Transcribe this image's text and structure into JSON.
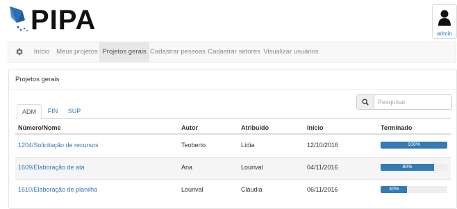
{
  "brand": {
    "name": "PIPA"
  },
  "user": {
    "name": "admin"
  },
  "nav": {
    "items": [
      "Início",
      "Meus projetos",
      "Projetos gerais",
      "Cadastrar pessoas",
      "Cadastrar setores",
      "Visualizar usuários"
    ],
    "active_index": 2
  },
  "panel": {
    "title": "Projetos gerais"
  },
  "search": {
    "placeholder": "Pesquisar"
  },
  "tabs": {
    "items": [
      "ADM",
      "FIN",
      "SUP"
    ],
    "active_index": 0
  },
  "table": {
    "headers": [
      "Número/Nome",
      "Autor",
      "Atribuido",
      "Início",
      "Terminado"
    ],
    "rows": [
      {
        "nome": "1204/Solicitação de recursos",
        "autor": "Teoberto",
        "atribuido": "Lídia",
        "inicio": "12/10/2016",
        "terminado": 100,
        "terminado_label": "100%"
      },
      {
        "nome": "1609/Elaboração de ata",
        "autor": "Ana",
        "atribuido": "Lourival",
        "inicio": "04/11/2016",
        "terminado": 80,
        "terminado_label": "80%"
      },
      {
        "nome": "1610/Elaboração de planilha",
        "autor": "Lourival",
        "atribuido": "Cláudia",
        "inicio": "06/11/2016",
        "terminado": 40,
        "terminado_label": "40%"
      }
    ]
  },
  "colors": {
    "accent": "#337ab7",
    "nav_bg": "#f8f8f8",
    "nav_active": "#e7e7e7"
  }
}
